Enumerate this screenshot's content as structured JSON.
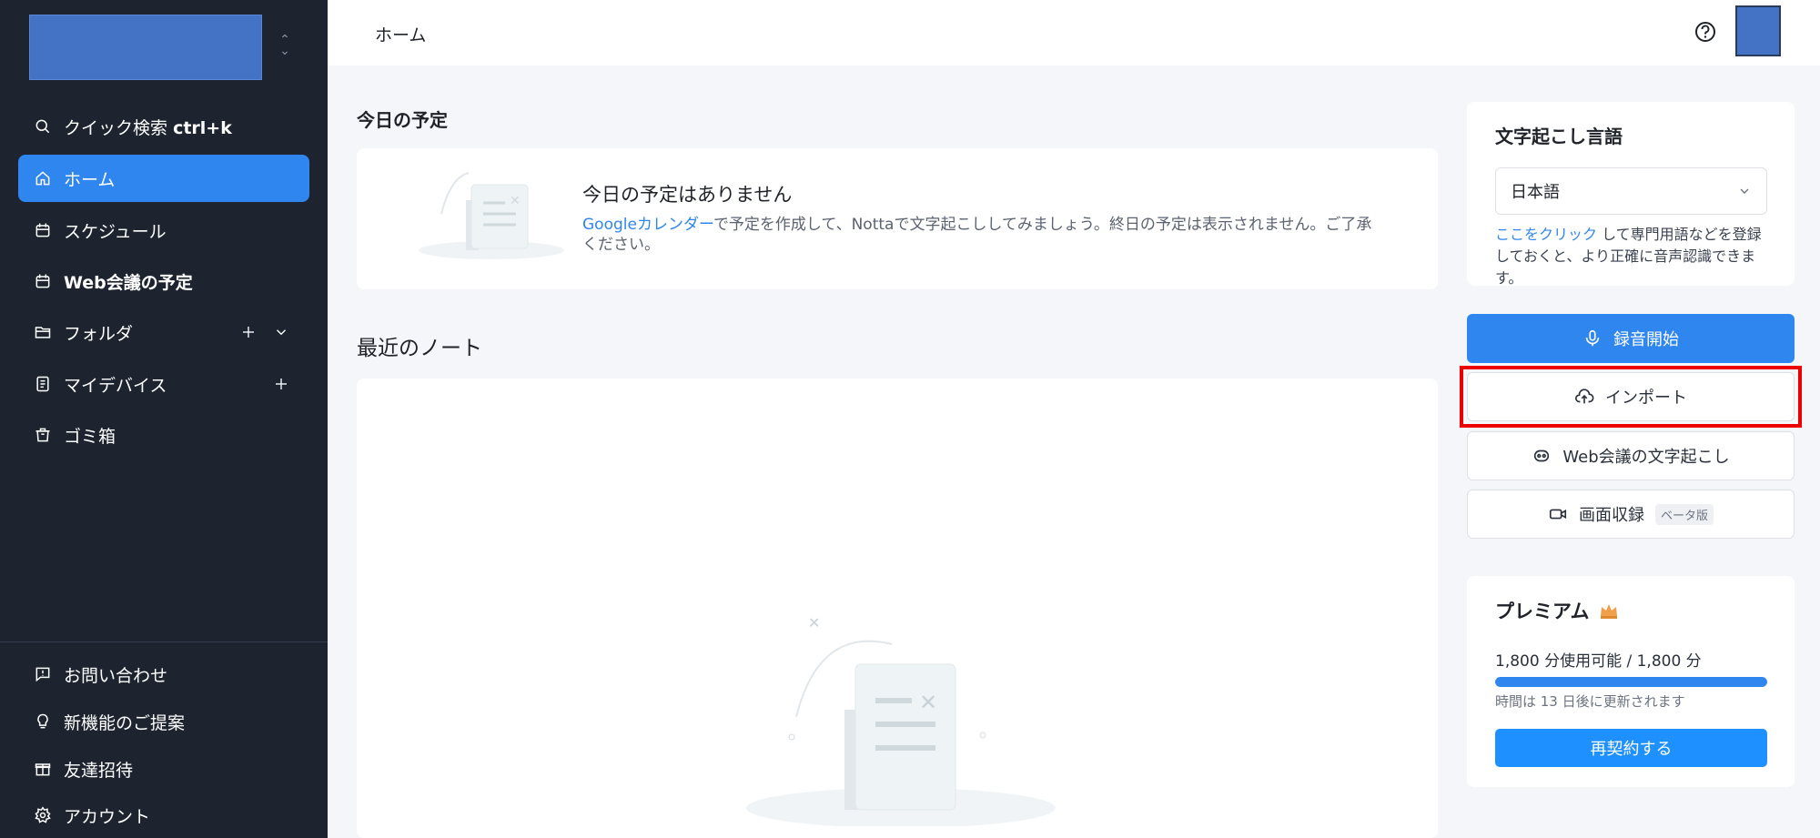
{
  "sidebar": {
    "quick_search": {
      "label": "クイック検索",
      "shortcut": "ctrl+k"
    },
    "items": [
      {
        "label": "ホーム",
        "icon": "home-icon",
        "active": true
      },
      {
        "label": "スケジュール",
        "icon": "calendar-icon"
      },
      {
        "label": "Web会議の予定",
        "icon": "calendar-icon"
      },
      {
        "label": "フォルダ",
        "icon": "folder-icon"
      },
      {
        "label": "マイデバイス",
        "icon": "device-icon"
      },
      {
        "label": "ゴミ箱",
        "icon": "trash-icon"
      }
    ],
    "bottom_items": [
      {
        "label": "お問い合わせ",
        "icon": "feedback-icon"
      },
      {
        "label": "新機能のご提案",
        "icon": "lightbulb-icon"
      },
      {
        "label": "友達招待",
        "icon": "gift-icon"
      },
      {
        "label": "アカウント",
        "icon": "gear-icon"
      }
    ]
  },
  "topbar": {
    "breadcrumb": "ホーム"
  },
  "today": {
    "title": "今日の予定",
    "empty_title": "今日の予定はありません",
    "desc_link": "Googleカレンダー",
    "desc_rest": "で予定を作成して、Nottaで文字起こししてみましょう。終日の予定は表示されません。ご了承ください。"
  },
  "recent": {
    "title": "最近のノート"
  },
  "language": {
    "title": "文字起こし言語",
    "selected": "日本語",
    "hint_link": "ここをクリック",
    "hint_rest": " して専門用語などを登録しておくと、より正確に音声認識できます。"
  },
  "actions": {
    "record": "録音開始",
    "import": "インポート",
    "web_meeting": "Web会議の文字起こし",
    "screen_record": "画面収録",
    "beta": "ベータ版"
  },
  "premium": {
    "title": "プレミアム",
    "usage": "1,800 分使用可能 / 1,800 分",
    "usage_fraction": 1.0,
    "renew_text": "時間は 13 日後に更新されます",
    "renew_button": "再契約する"
  },
  "colors": {
    "accent": "#2f86ee",
    "sidebar": "#1d2430",
    "highlight": "#ee0000"
  }
}
